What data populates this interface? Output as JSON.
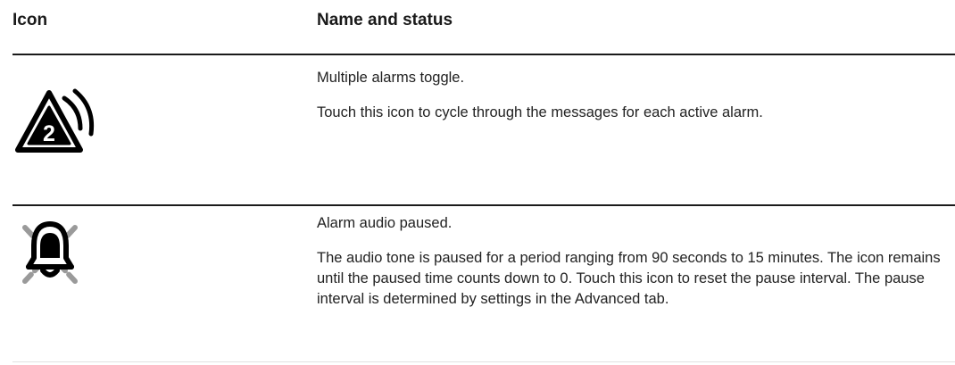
{
  "table": {
    "header": {
      "icon": "Icon",
      "name_status": "Name and status"
    },
    "rows": [
      {
        "icon_name": "multiple-alarms-icon",
        "name": "Multiple alarms toggle.",
        "status": "Touch this icon to cycle through the messages for each active alarm.",
        "icon_badge": "2"
      },
      {
        "icon_name": "alarm-audio-paused-icon",
        "name": "Alarm audio paused.",
        "status": "The audio tone is paused for a period ranging from 90 seconds to 15 minutes. The icon remains until the paused time counts down to 0. Touch this icon to reset the pause interval. The pause interval is determined by settings in the Advanced tab."
      }
    ]
  }
}
